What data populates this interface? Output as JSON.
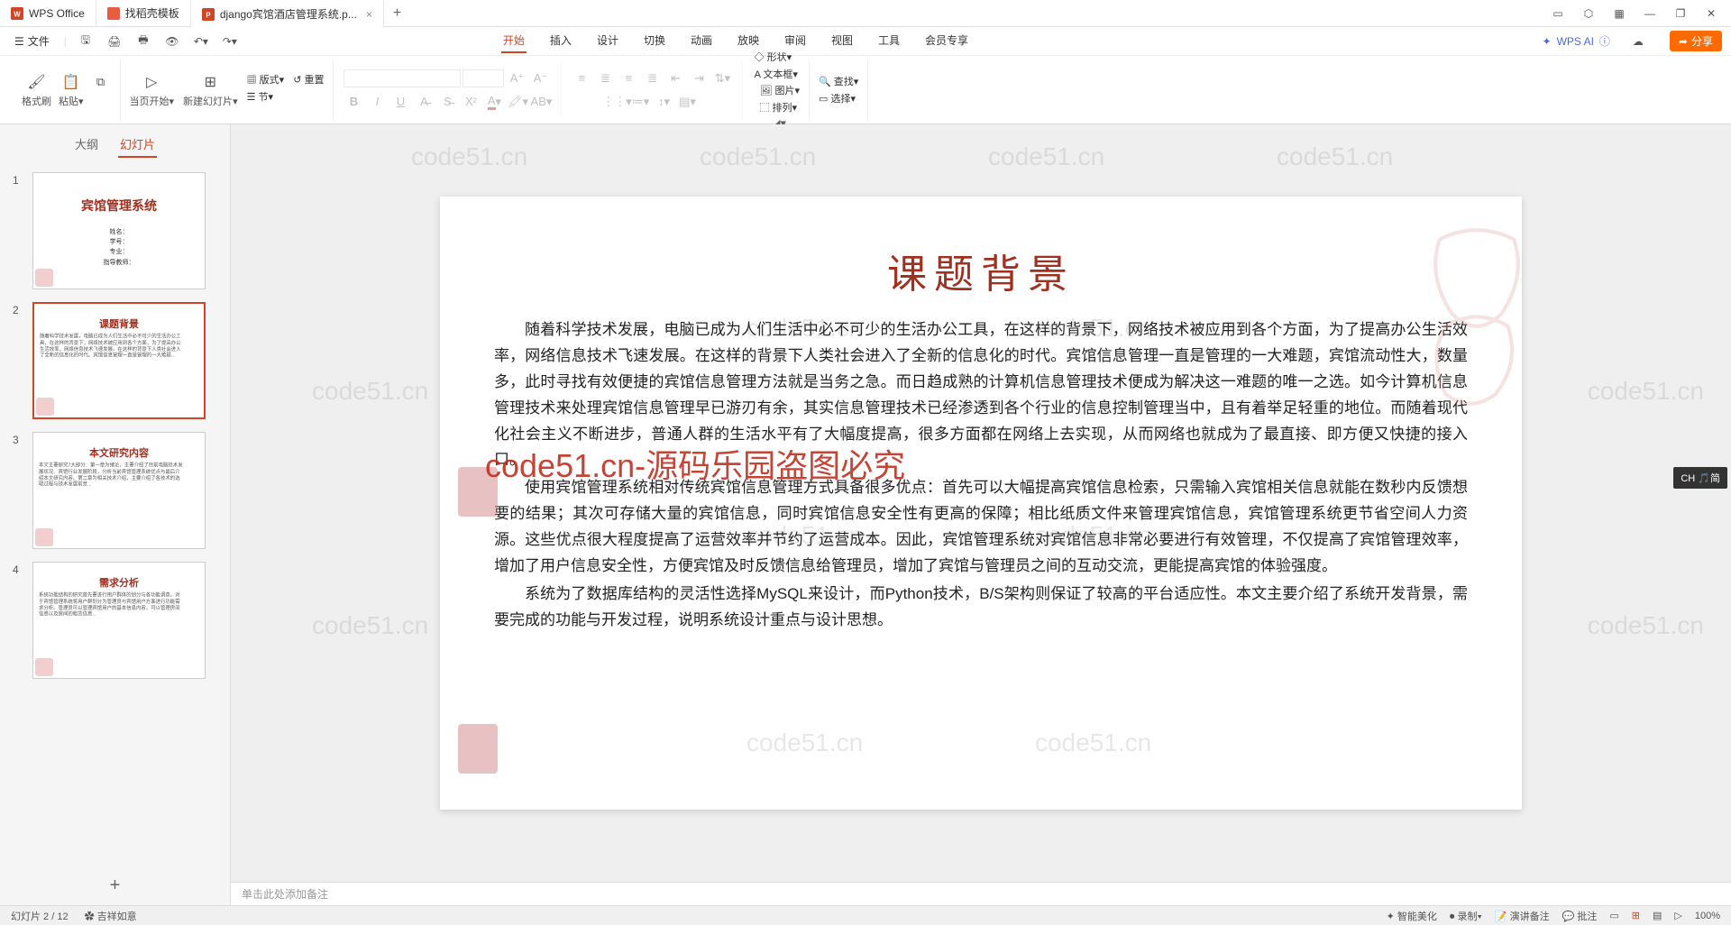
{
  "tabs": {
    "t1": "WPS Office",
    "t2": "找稻壳模板",
    "t3": "django宾馆酒店管理系统.p..."
  },
  "quick": {
    "menu": "文件"
  },
  "ribbonTabs": {
    "start": "开始",
    "insert": "插入",
    "design": "设计",
    "transition": "切换",
    "animation": "动画",
    "slideshow": "放映",
    "review": "审阅",
    "view": "视图",
    "tools": "工具",
    "member": "会员专享"
  },
  "ai": "WPS AI",
  "share": "分享",
  "ribbon": {
    "formatPainter": "格式刷",
    "paste": "粘贴",
    "pageStart": "当页开始",
    "newSlide": "新建幻灯片",
    "layout": "版式",
    "section": "节",
    "reset": "重置",
    "shape": "形状",
    "picture": "图片",
    "textBox": "文本框",
    "arrange": "排列",
    "find": "查找",
    "select": "选择"
  },
  "side": {
    "outline": "大纲",
    "slides": "幻灯片"
  },
  "thumbs": {
    "t1": "宾馆管理系统",
    "t1sub1": "姓名：",
    "t1sub2": "学号：",
    "t1sub3": "专业：",
    "t1sub4": "指导教师：",
    "t2": "课题背景",
    "t3": "本文研究内容",
    "t4": "需求分析"
  },
  "slide": {
    "title": "课题背景",
    "p1": "随着科学技术发展，电脑已成为人们生活中必不可少的生活办公工具，在这样的背景下，网络技术被应用到各个方面，为了提高办公生活效率，网络信息技术飞速发展。在这样的背景下人类社会进入了全新的信息化的时代。宾馆信息管理一直是管理的一大难题，宾馆流动性大，数量多，此时寻找有效便捷的宾馆信息管理方法就是当务之急。而日趋成熟的计算机信息管理技术便成为解决这一难题的唯一之选。如今计算机信息管理技术来处理宾馆信息管理早已游刃有余，其实信息管理技术已经渗透到各个行业的信息控制管理当中，且有着举足轻重的地位。而随着现代化社会主义不断进步，普通人群的生活水平有了大幅度提高，很多方面都在网络上去实现，从而网络也就成为了最直接、即方便又快捷的接入口。",
    "p2": "使用宾馆管理系统相对传统宾馆信息管理方式具备很多优点：首先可以大幅提高宾馆信息检索，只需输入宾馆相关信息就能在数秒内反馈想要的结果；其次可存储大量的宾馆信息，同时宾馆信息安全性有更高的保障；相比纸质文件来管理宾馆信息，宾馆管理系统更节省空间人力资源。这些优点很大程度提高了运营效率并节约了运营成本。因此，宾馆管理系统对宾馆信息非常必要进行有效管理，不仅提高了宾馆管理效率，增加了用户信息安全性，方便宾馆及时反馈信息给管理员，增加了宾馆与管理员之间的互动交流，更能提高宾馆的体验强度。",
    "p3": "系统为了数据库结构的灵活性选择MySQL来设计，而Python技术，B/S架构则保证了较高的平台适应性。本文主要介绍了系统开发背景，需要完成的功能与开发过程，说明系统设计重点与设计思想。"
  },
  "watermark": {
    "main": "code51.cn-源码乐园盗图必究",
    "bg": "code51.cn"
  },
  "notes": "单击此处添加备注",
  "status": {
    "slide": "幻灯片 2 / 12",
    "author": "吉祥如意",
    "smart": "智能美化",
    "record": "录制",
    "speech": "演讲备注",
    "comment": "批注",
    "zoom": "100%"
  },
  "ime": "CH 🎵简"
}
